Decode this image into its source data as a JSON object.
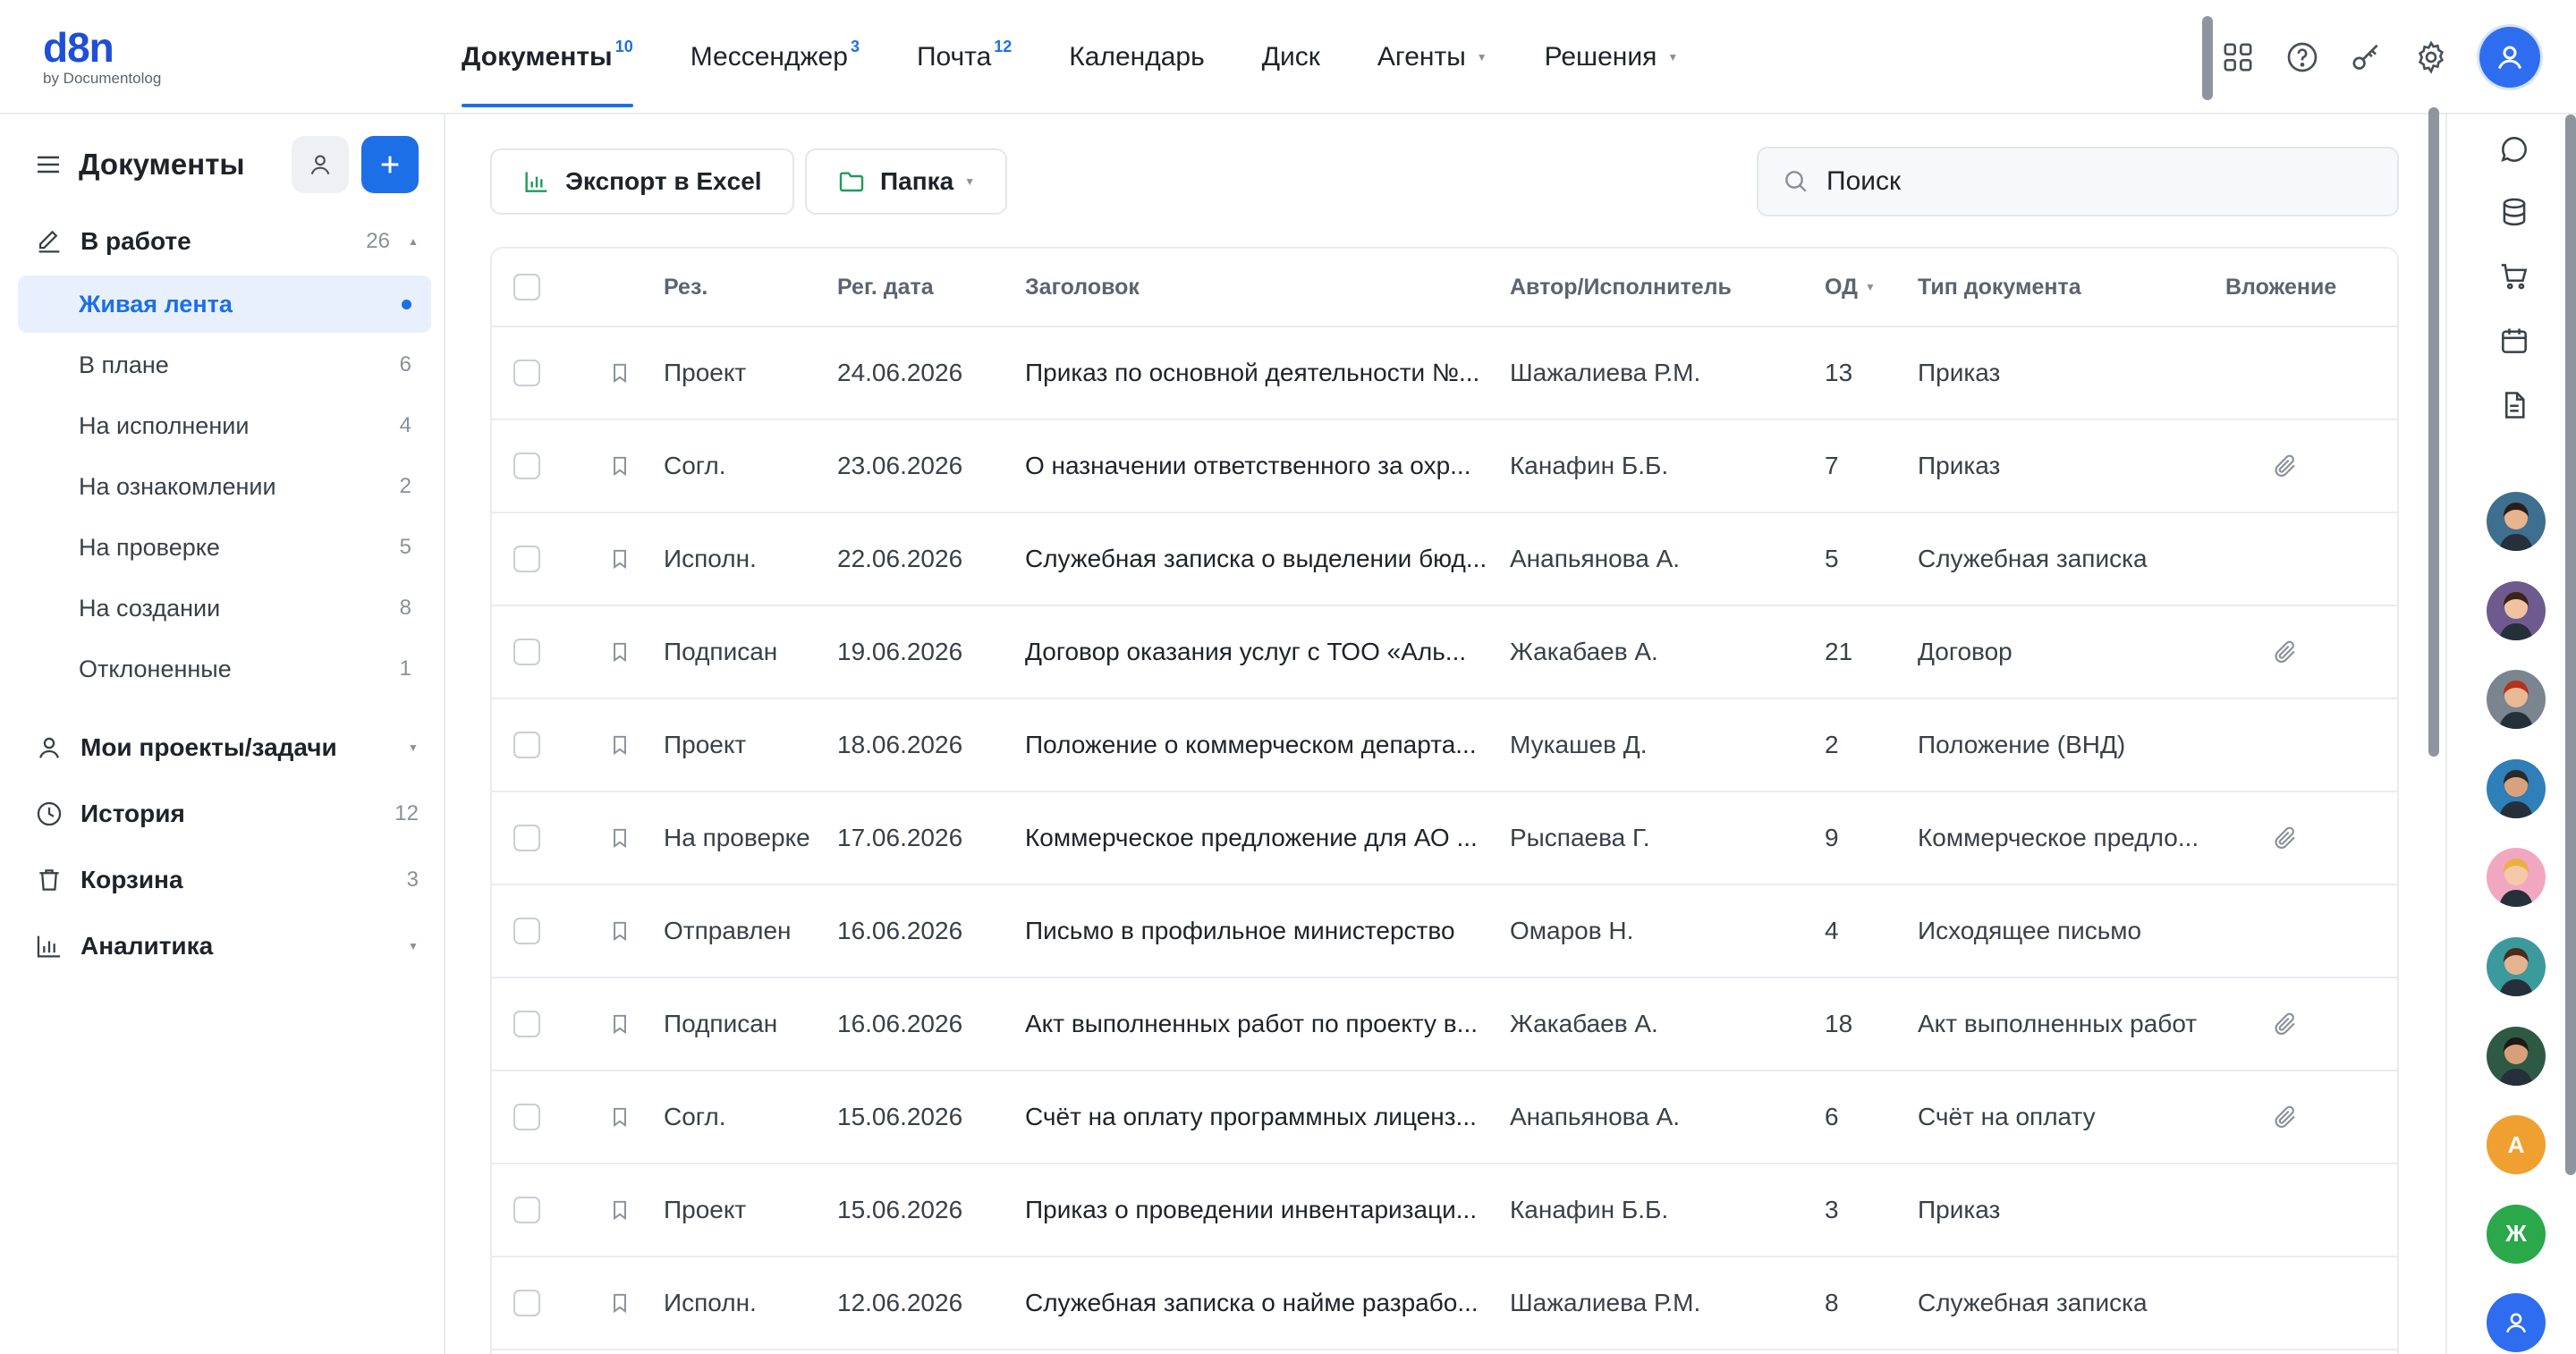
{
  "logo": {
    "main": "d8n",
    "sub": "by Documentolog"
  },
  "nav": {
    "tabs": [
      {
        "label": "Документы",
        "badge": "10",
        "active": true
      },
      {
        "label": "Мессенджер",
        "badge": "3"
      },
      {
        "label": "Почта",
        "badge": "12"
      },
      {
        "label": "Календарь",
        "badge": ""
      },
      {
        "label": "Диск",
        "badge": ""
      },
      {
        "label": "Агенты",
        "badge": "",
        "dropdown": true
      },
      {
        "label": "Решения",
        "badge": "",
        "dropdown": true
      }
    ],
    "icons": [
      "grid-icon",
      "help-icon",
      "key-icon",
      "settings-icon"
    ]
  },
  "sidebar": {
    "title": "Документы",
    "in_work": {
      "label": "В работе",
      "count": "26"
    },
    "items": [
      {
        "label": "Живая лента",
        "count": "",
        "active": true
      },
      {
        "label": "В плане",
        "count": "6"
      },
      {
        "label": "На исполнении",
        "count": "4"
      },
      {
        "label": "На ознакомлении",
        "count": "2"
      },
      {
        "label": "На проверке",
        "count": "5"
      },
      {
        "label": "На создании",
        "count": "8"
      },
      {
        "label": "Отклоненные",
        "count": "1"
      }
    ],
    "projects": {
      "label": "Мои проекты/задачи"
    },
    "history": {
      "label": "История",
      "count": "12"
    },
    "trash": {
      "label": "Корзина",
      "count": "3"
    },
    "analytics": {
      "label": "Аналитика"
    }
  },
  "toolbar": {
    "export_label": "Экспорт в Excel",
    "folder_label": "Папка",
    "search_placeholder": "Поиск"
  },
  "table": {
    "headers": {
      "res": "Рез.",
      "reg_date": "Рег. дата",
      "title": "Заголовок",
      "author": "Автор/Исполнитель",
      "od": "ОД",
      "doc_type": "Тип документа",
      "attachment": "Вложение"
    },
    "rows": [
      {
        "res": "Проект",
        "date": "24.06.2026",
        "title": "Приказ по основной деятельности №...",
        "author": "Шажалиева Р.М.",
        "od": "13",
        "type": "Приказ",
        "attach": false
      },
      {
        "res": "Согл.",
        "date": "23.06.2026",
        "title": "О назначении ответственного за охр...",
        "author": "Канафин Б.Б.",
        "od": "7",
        "type": "Приказ",
        "attach": true
      },
      {
        "res": "Исполн.",
        "date": "22.06.2026",
        "title": "Служебная записка о выделении бюд...",
        "author": "Анапьянова А.",
        "od": "5",
        "type": "Служебная записка",
        "attach": false
      },
      {
        "res": "Подписан",
        "date": "19.06.2026",
        "title": "Договор оказания услуг с ТОО «Аль...",
        "author": "Жакабаев А.",
        "od": "21",
        "type": "Договор",
        "attach": true
      },
      {
        "res": "Проект",
        "date": "18.06.2026",
        "title": "Положение о коммерческом департа...",
        "author": "Мукашев Д.",
        "od": "2",
        "type": "Положение (ВНД)",
        "attach": false
      },
      {
        "res": "На проверке",
        "date": "17.06.2026",
        "title": "Коммерческое предложение для АО ...",
        "author": "Рыспаева Г.",
        "od": "9",
        "type": "Коммерческое предло...",
        "attach": true
      },
      {
        "res": "Отправлен",
        "date": "16.06.2026",
        "title": "Письмо в профильное министерство",
        "author": "Омаров Н.",
        "od": "4",
        "type": "Исходящее письмо",
        "attach": false
      },
      {
        "res": "Подписан",
        "date": "16.06.2026",
        "title": "Акт выполненных работ по проекту в...",
        "author": "Жакабаев А.",
        "od": "18",
        "type": "Акт выполненных работ",
        "attach": true
      },
      {
        "res": "Согл.",
        "date": "15.06.2026",
        "title": "Счёт на оплату программных лиценз...",
        "author": "Анапьянова А.",
        "od": "6",
        "type": "Счёт на оплату",
        "attach": true
      },
      {
        "res": "Проект",
        "date": "15.06.2026",
        "title": "Приказ о проведении инвентаризаци...",
        "author": "Канафин Б.Б.",
        "od": "3",
        "type": "Приказ",
        "attach": false
      },
      {
        "res": "Исполн.",
        "date": "12.06.2026",
        "title": "Служебная записка о найме разрабо...",
        "author": "Шажалиева Р.М.",
        "od": "8",
        "type": "Служебная записка",
        "attach": false
      }
    ]
  },
  "rail": {
    "icons": [
      "chat-icon",
      "database-icon",
      "cart-icon",
      "calendar-icon",
      "document-icon"
    ],
    "avatars": [
      {
        "kind": "photo",
        "bg": "#3f6f8f",
        "skin": "#e8b48e",
        "hair": "#2a1e18"
      },
      {
        "kind": "photo",
        "bg": "#6f5a8f",
        "skin": "#f0c2a0",
        "hair": "#3a2418"
      },
      {
        "kind": "photo",
        "bg": "#7a8590",
        "skin": "#e9b896",
        "hair": "#b3331c"
      },
      {
        "kind": "photo",
        "bg": "#2f7fb8",
        "skin": "#d9a27a",
        "hair": "#2a2a2a"
      },
      {
        "kind": "photo",
        "bg": "#f2a7c0",
        "skin": "#f3c9a8",
        "hair": "#e9b040"
      },
      {
        "kind": "photo",
        "bg": "#3c9a9c",
        "skin": "#e5b38f",
        "hair": "#4a2c1c"
      },
      {
        "kind": "photo",
        "bg": "#2e5a45",
        "skin": "#d8a07a",
        "hair": "#1e1a16"
      },
      {
        "kind": "letter",
        "bg": "#f0a030",
        "letter": "А"
      },
      {
        "kind": "letter",
        "bg": "#2aa84a",
        "letter": "Ж"
      },
      {
        "kind": "user",
        "bg": "#2f6df0"
      }
    ]
  }
}
